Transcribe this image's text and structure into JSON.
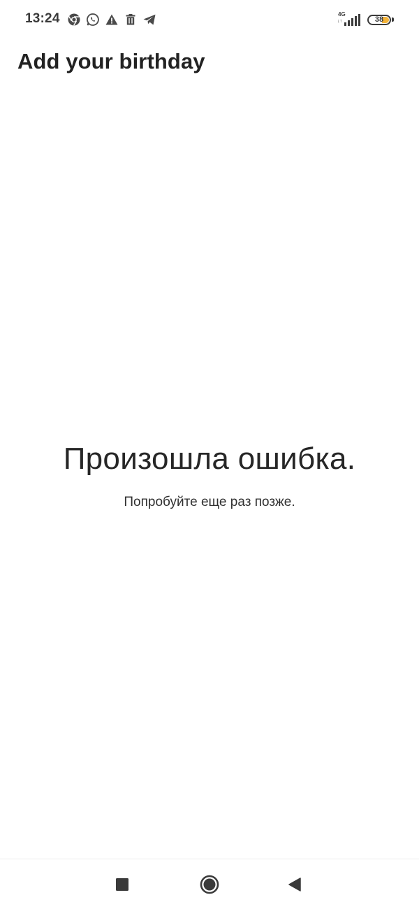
{
  "status_bar": {
    "time": "13:24",
    "network_type": "4G",
    "network_arrows": "↓↑",
    "battery_level": "38",
    "notification_icons": [
      "chrome-icon",
      "whatsapp-icon",
      "warning-icon",
      "trash-icon",
      "telegram-icon"
    ],
    "colors": {
      "icon": "#3a3a3a",
      "battery_fill": "#f4b43a"
    }
  },
  "header": {
    "title": "Add your birthday"
  },
  "error": {
    "title": "Произошла ошибка.",
    "subtitle": "Попробуйте еще раз позже."
  },
  "nav_bar": {
    "buttons": [
      "recents-icon",
      "home-icon",
      "back-icon"
    ]
  }
}
